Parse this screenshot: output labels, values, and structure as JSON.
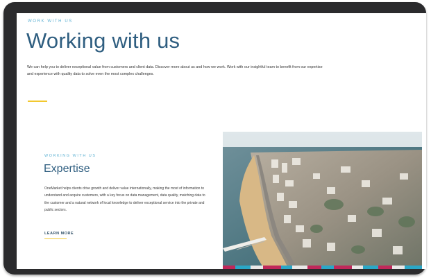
{
  "hero": {
    "eyebrow": "WORK WITH US",
    "title": "Working with us",
    "intro": "We can help you to deliver exceptional value from customers and client data. Discover more about us and how we work. Work with our insightful team to benefit from our expertise and experience with quality data to solve even the most complex challenges."
  },
  "card": {
    "eyebrow": "WORKING WITH US",
    "title": "Expertise",
    "body": "OneMarket helps clients drive growth and deliver value internationally, making the most of information to understand and acquire customers, with a key focus on data management, data quality, matching data to the customer and a natural network of local knowledge to deliver exceptional service into the private and public sectors.",
    "link_label": "LEARN MORE"
  },
  "photo": {
    "icon": "coastal-city-aerial-photo",
    "footer_strip_colors": [
      "#c0285a",
      "#2aa7c7",
      "#e8e8e8",
      "#c0285a",
      "#2aa7c7"
    ]
  },
  "colors": {
    "accent_blue": "#2f5e80",
    "eyebrow_blue": "#5fb2d3",
    "rule_yellow": "#f2c82f",
    "device_frame": "#2b2b2d"
  }
}
